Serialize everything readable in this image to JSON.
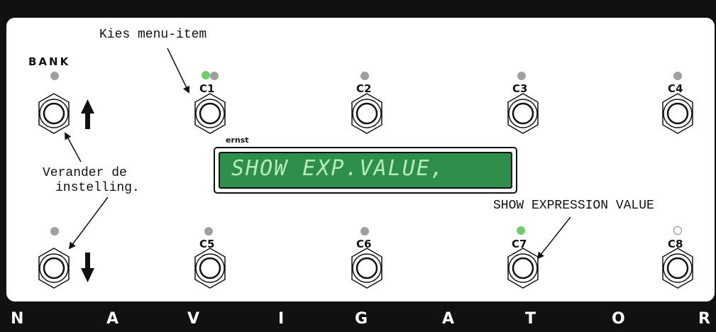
{
  "brand_letters": [
    "N",
    "A",
    "V",
    "I",
    "G",
    "A",
    "T",
    "O",
    "R"
  ],
  "bank_label": "BANK",
  "switches_top": [
    {
      "label": "C1",
      "led": "green-gray"
    },
    {
      "label": "C2",
      "led": "gray"
    },
    {
      "label": "C3",
      "led": "gray"
    },
    {
      "label": "C4",
      "led": "gray"
    }
  ],
  "switches_bottom": [
    {
      "label": "C5",
      "led": "gray"
    },
    {
      "label": "C6",
      "led": "gray"
    },
    {
      "label": "C7",
      "led": "green"
    },
    {
      "label": "C8",
      "led": "off"
    }
  ],
  "display": {
    "owner": "ernst",
    "text": "SHOW EXP.VALUE,"
  },
  "annotations": {
    "choose_item": "Kies menu-item",
    "change_setting_line1": "Verander de",
    "change_setting_line2": "instelling.",
    "show_expression": "SHOW EXPRESSION VALUE"
  },
  "colors": {
    "frame": "#111111",
    "panel": "#ffffff",
    "lcd_bg": "#2e8f4a",
    "lcd_text": "#b6ecb8",
    "led_gray": "#a0a0a0",
    "led_green": "#6fcf6a"
  }
}
